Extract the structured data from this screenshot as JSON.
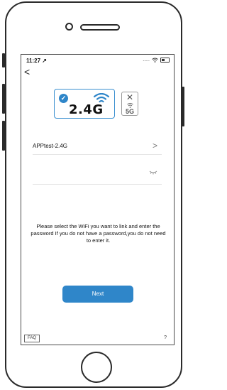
{
  "status_bar": {
    "time": "11:27 ↗",
    "signal": ".....",
    "icons": [
      "wifi-icon",
      "battery-icon"
    ]
  },
  "nav": {
    "back_label": "<"
  },
  "bands": {
    "primary": {
      "label": "2.4G",
      "selected": true,
      "color": "#2f86c9"
    },
    "secondary": {
      "label": "5G",
      "selected": false,
      "mark": "✕"
    }
  },
  "wifi_form": {
    "ssid_value": "APPtest-2.4G",
    "ssid_chevron": ">",
    "password_value": ""
  },
  "info_text": "Please select the WiFi you want to link and enter the password If you do not have a password,you do not need to enter it.",
  "next_button": "Next",
  "footer": {
    "faq": "FAQ",
    "help": "?"
  }
}
